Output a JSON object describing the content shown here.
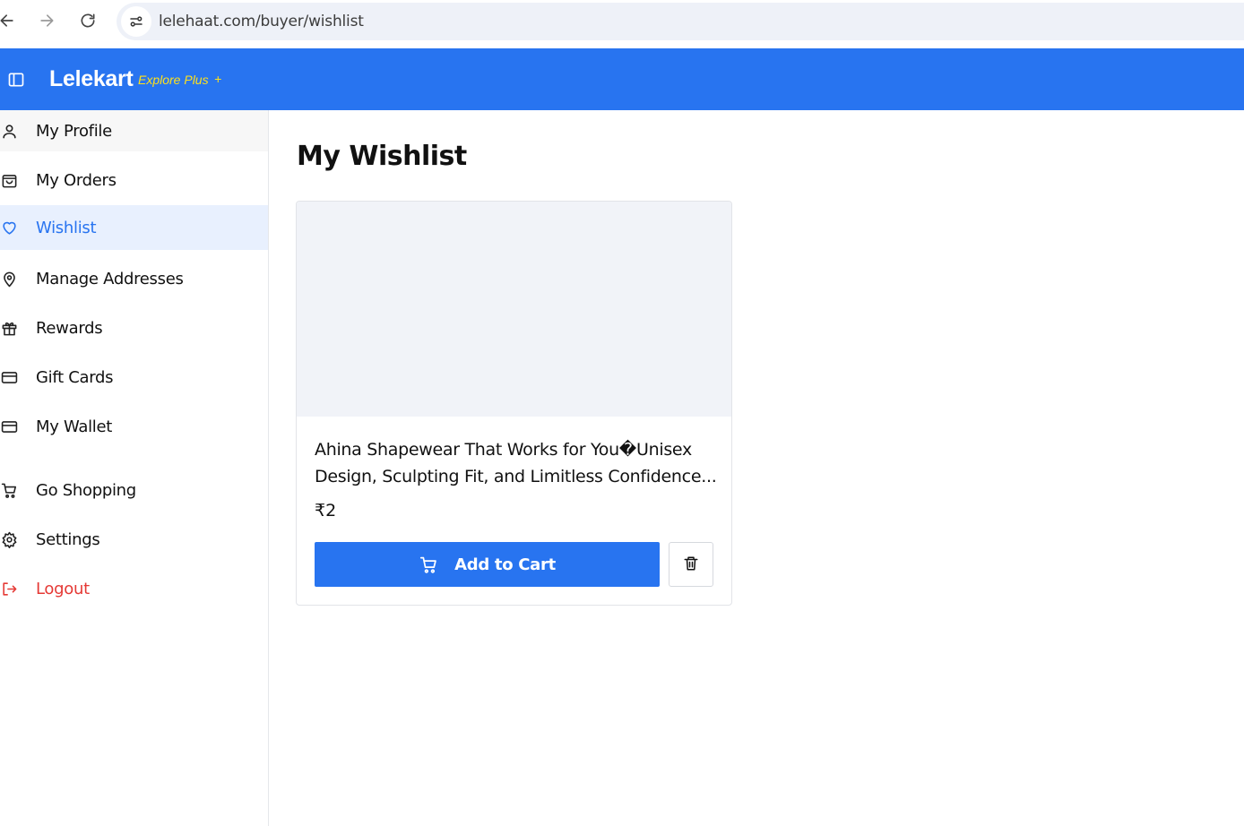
{
  "browser": {
    "url": "lelehaat.com/buyer/wishlist",
    "icons": [
      "back-arrow-icon",
      "forward-arrow-icon",
      "reload-icon",
      "site-info-icon"
    ]
  },
  "header": {
    "brand": "Lelekart",
    "brand_sub": "Explore Plus",
    "brand_plus": "+",
    "colors": {
      "background": "#2874f0",
      "accent": "#ffe11b"
    }
  },
  "sidebar": {
    "items": [
      {
        "label": "My Profile",
        "icon": "user-icon"
      },
      {
        "label": "My Orders",
        "icon": "shopping-bag-icon"
      },
      {
        "label": "Wishlist",
        "icon": "heart-icon",
        "active": true
      },
      {
        "label": "Manage Addresses",
        "icon": "map-pin-icon"
      },
      {
        "label": "Rewards",
        "icon": "gift-icon"
      },
      {
        "label": "Gift Cards",
        "icon": "credit-card-icon"
      },
      {
        "label": "My Wallet",
        "icon": "wallet-icon"
      },
      {
        "label": "Go Shopping",
        "icon": "cart-icon"
      },
      {
        "label": "Settings",
        "icon": "gear-icon"
      },
      {
        "label": "Logout",
        "icon": "logout-icon"
      }
    ]
  },
  "main": {
    "title": "My Wishlist",
    "products": [
      {
        "name": "Ahina Shapewear That Works for You�Unisex Design, Sculpting Fit, and Limitless Confidence...",
        "price": "₹2",
        "add_to_cart_label": "Add to Cart"
      }
    ]
  }
}
